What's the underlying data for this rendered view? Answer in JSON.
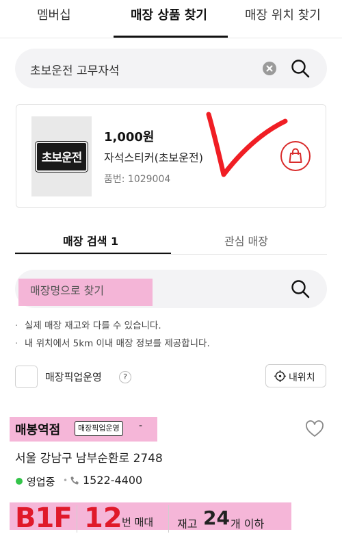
{
  "top_tabs": {
    "membership": "멤버십",
    "find_product": "매장 상품 찾기",
    "find_location": "매장 위치 찾기"
  },
  "search": {
    "query": "초보운전 고무자석"
  },
  "product": {
    "price": "1,000원",
    "name": "자석스티커(초보운전)",
    "code": "품번: 1029004",
    "thumb_text": "초보운전"
  },
  "store_tabs": {
    "search": "매장 검색 1",
    "favorites": "관심 매장"
  },
  "store_search": {
    "placeholder": "매장명으로 찾기"
  },
  "notices": [
    "실제 매장 재고와 다를 수 있습니다.",
    "내 위치에서 5km 이내 매장 정보를 제공합니다."
  ],
  "filter": {
    "pickup_label": "매장픽업운영",
    "help": "?",
    "my_location": "내위치"
  },
  "store": {
    "name": "매봉역점",
    "badge": "매장픽업운영",
    "dash": "-",
    "address": "서울 강남구 남부순환로 2748",
    "status": "영업중",
    "separator": "•",
    "phone": "1522-4400",
    "floor": "B1F",
    "shelf_number": "12",
    "shelf_unit": "번 매대",
    "stock_label": "재고",
    "stock_count": "24",
    "stock_suffix": "개 이하"
  },
  "colors": {
    "accent_red": "#e0192a",
    "open_green": "#34c44a",
    "highlight_pink": "#f3a9d1"
  }
}
